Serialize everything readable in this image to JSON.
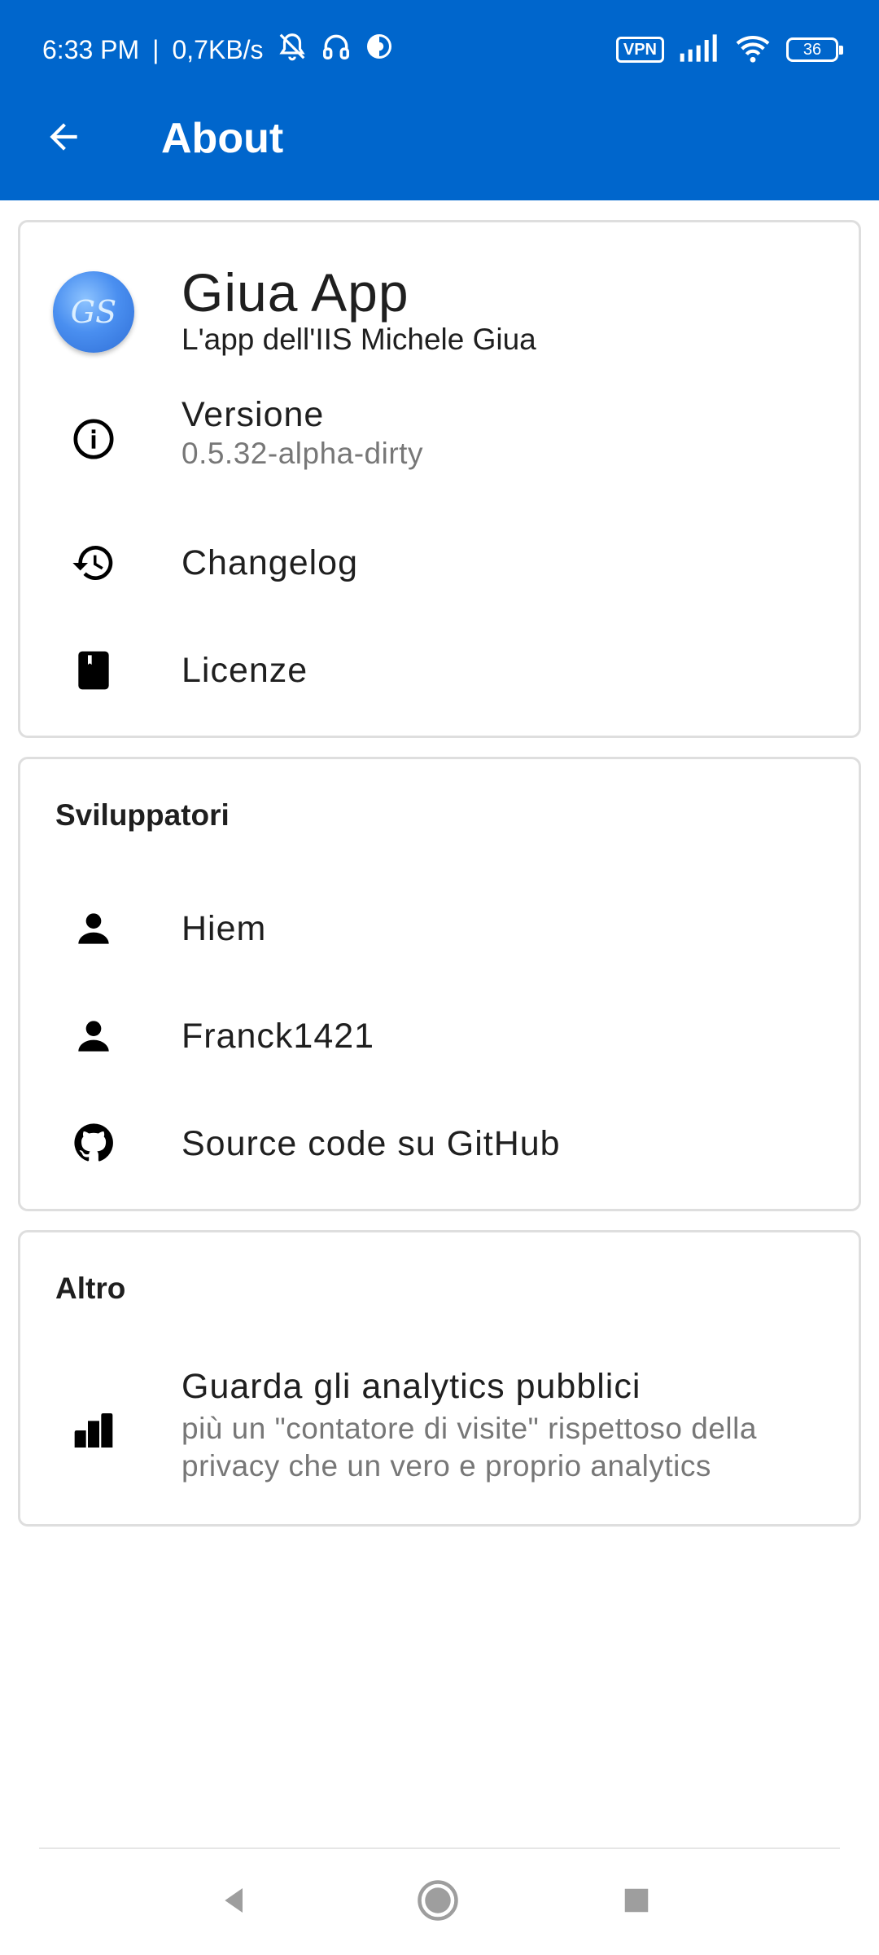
{
  "status_bar": {
    "time": "6:33 PM",
    "separator": "|",
    "net_speed": "0,7KB/s",
    "vpn_label": "VPN",
    "battery_level": "36"
  },
  "app_bar": {
    "title": "About"
  },
  "about_card": {
    "app_name": "Giua App",
    "app_subtitle": "L'app dell'IIS Michele Giua",
    "logo_text": "GS",
    "version_label": "Versione",
    "version_value": "0.5.32-alpha-dirty",
    "changelog_label": "Changelog",
    "licenses_label": "Licenze"
  },
  "developers_card": {
    "title": "Sviluppatori",
    "items": [
      {
        "label": "Hiem",
        "icon": "person-icon"
      },
      {
        "label": "Franck1421",
        "icon": "person-icon"
      },
      {
        "label": "Source code su GitHub",
        "icon": "github-icon"
      }
    ]
  },
  "other_card": {
    "title": "Altro",
    "analytics_label": "Guarda gli analytics pubblici",
    "analytics_description": "più un \"contatore di visite\" rispettoso della privacy che un vero e proprio analytics",
    "analytics_icon": "leaderboard-icon"
  },
  "nav_bar": {
    "back_icon": "triangle-back-icon",
    "home_icon": "circle-home-icon",
    "recents_icon": "square-recents-icon"
  },
  "colors": {
    "app_bar": "#0066cc",
    "card_border": "#dedede",
    "secondary_text": "#777777"
  }
}
